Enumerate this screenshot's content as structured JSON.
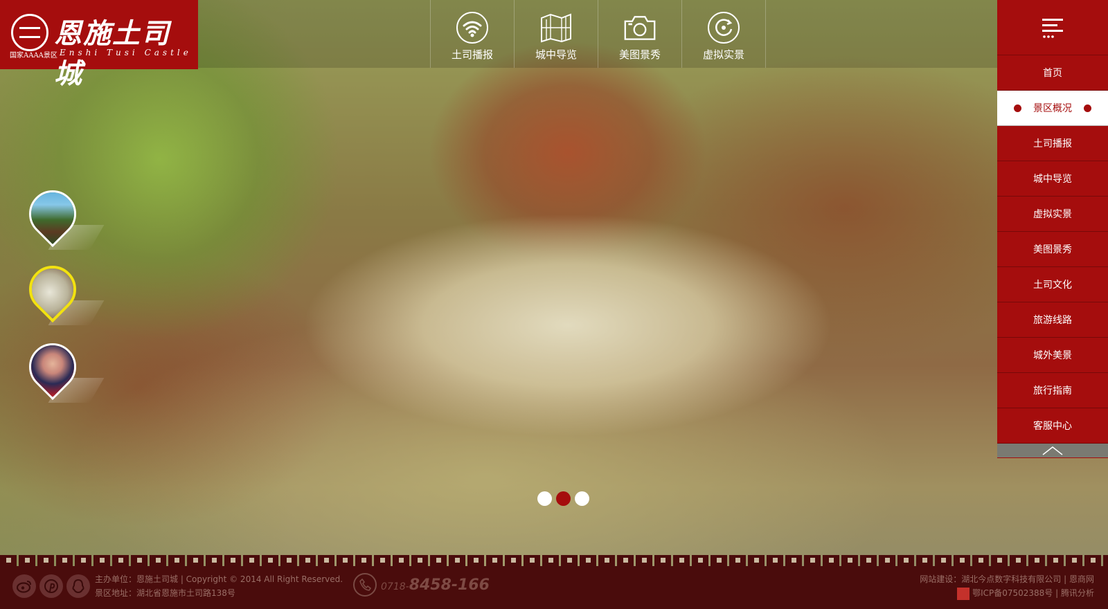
{
  "colors": {
    "brand_red": "#a50d0d",
    "footer_bg": "#4a0c0c",
    "active_pin": "#f2e210",
    "footer_text": "#9a6e66"
  },
  "logo": {
    "title": "恩施土司城",
    "level": "国家AAAA景区",
    "subtitle_en": "Enshi Tusi Castle",
    "seal_text": "恩施土司城"
  },
  "top_nav": [
    {
      "label": "土司播报",
      "icon": "wifi-icon"
    },
    {
      "label": "城中导览",
      "icon": "map-icon"
    },
    {
      "label": "美图景秀",
      "icon": "camera-icon"
    },
    {
      "label": "虚拟实景",
      "icon": "rotate-360-icon"
    }
  ],
  "side_menu": {
    "toggle_icon": "menu-icon",
    "items": [
      {
        "label": "首页",
        "active": false
      },
      {
        "label": "景区概况",
        "active": true
      },
      {
        "label": "土司播报",
        "active": false
      },
      {
        "label": "城中导览",
        "active": false
      },
      {
        "label": "虚拟实景",
        "active": false
      },
      {
        "label": "美图景秀",
        "active": false
      },
      {
        "label": "土司文化",
        "active": false
      },
      {
        "label": "旅游线路",
        "active": false
      },
      {
        "label": "城外美景",
        "active": false
      },
      {
        "label": "旅行指南",
        "active": false
      },
      {
        "label": "客服中心",
        "active": false
      }
    ],
    "up_icon": "chevron-up-icon"
  },
  "thumbnails": [
    {
      "name": "pavilion-thumbnail",
      "active": false
    },
    {
      "name": "tiger-statue-thumbnail",
      "active": true
    },
    {
      "name": "costume-girl-thumbnail",
      "active": false
    }
  ],
  "slider": {
    "count": 3,
    "active_index": 1
  },
  "footer": {
    "social_icons": [
      "weibo-icon",
      "pinterest-icon",
      "qq-icon"
    ],
    "host_line": "主办单位：恩施土司城 |  Copyright  © 2014 All Right Reserved.",
    "address_line": "景区地址：湖北省恩施市土司路138号",
    "phone_prefix": "0718-",
    "phone_number": "8458-166",
    "builder_prefix": "网站建设：",
    "builder_name": "湖北今点数字科技有限公司",
    "builder_sep": " | ",
    "builder_link": "恩商网",
    "icp_text": "鄂ICP备07502388号",
    "icp_sep": " | ",
    "analytics_link": "腾讯分析"
  }
}
